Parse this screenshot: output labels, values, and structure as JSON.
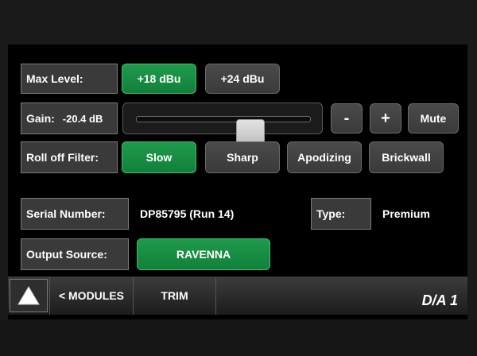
{
  "max_level": {
    "label": "Max Level:",
    "options": [
      {
        "label": "+18 dBu",
        "active": true
      },
      {
        "label": "+24 dBu",
        "active": false
      }
    ]
  },
  "gain": {
    "label": "Gain:",
    "value": "-20.4 dB",
    "slider_fraction": 0.65,
    "minus_label": "-",
    "plus_label": "+",
    "mute_label": "Mute"
  },
  "roll_off_filter": {
    "label": "Roll off Filter:",
    "options": [
      {
        "label": "Slow",
        "active": true
      },
      {
        "label": "Sharp",
        "active": false
      },
      {
        "label": "Apodizing",
        "active": false
      },
      {
        "label": "Brickwall",
        "active": false
      }
    ]
  },
  "serial": {
    "label": "Serial Number:",
    "value": "DP85795 (Run 14)"
  },
  "type": {
    "label": "Type:",
    "value": "Premium"
  },
  "output_source": {
    "label": "Output Source:",
    "value": "RAVENNA"
  },
  "nav": {
    "modules_label": "< MODULES",
    "trim_label": "TRIM",
    "module_id": "D/A 1",
    "home_icon": "triangle-home-icon"
  },
  "colors": {
    "active_green": "#12803b",
    "panel_gray": "#3a3a3a",
    "background": "#000000"
  }
}
